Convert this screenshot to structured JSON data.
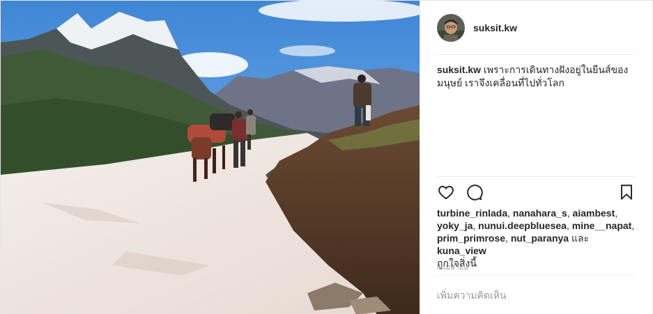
{
  "post": {
    "username": "suksit.kw",
    "caption_user": "suksit.kw",
    "caption_text": "เพราะการเดินทางฝังอยู่ในยีนส์ของมนุษย์ เราจึงเคลื่อนที่ไปทั่วโลก",
    "likers": [
      "turbine_rinlada",
      "nanahara_s",
      "aiambest",
      "yoky_ja",
      "nunui.deepbluesea",
      "mine__napat",
      "prim_primrose",
      "nut_paranya"
    ],
    "likers_last": "kuna_view",
    "likes_joiner": "และ",
    "likes_suffix": "ถูกใจสิ่งนี้",
    "timestamp": "4 เมษายน",
    "comment_placeholder": "เพิ่มความคิดเห็น"
  },
  "icons": {
    "like": "heart-icon",
    "comment": "comment-bubble-icon",
    "save": "bookmark-icon"
  },
  "colors": {
    "text": "#262626",
    "muted": "#999999",
    "divider": "#efefef"
  }
}
